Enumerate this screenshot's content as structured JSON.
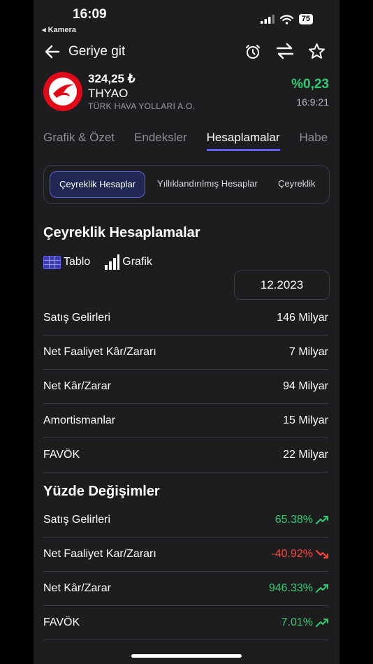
{
  "status_bar": {
    "time": "16:09",
    "back_app": "◂ Kamera",
    "battery": "75"
  },
  "nav": {
    "back_label": "Geriye git"
  },
  "stock": {
    "price": "324,25 ₺",
    "ticker": "THYAO",
    "company": "TÜRK HAVA YOLLARI A.O.",
    "change": "%0,23",
    "time": "16:9:21"
  },
  "tabs": [
    {
      "label": "Grafik & Özet"
    },
    {
      "label": "Endeksler"
    },
    {
      "label": "Hesaplamalar"
    },
    {
      "label": "Habe"
    }
  ],
  "segments": [
    {
      "label": "Çeyreklik Hesaplar"
    },
    {
      "label": "Yıllıklandırılmış Hesaplar"
    },
    {
      "label": "Çeyreklik"
    }
  ],
  "section_title": "Çeyreklik Hesaplamalar",
  "view_switch": {
    "table": "Tablo",
    "chart": "Grafik"
  },
  "period": "12.2023",
  "rows": [
    {
      "label": "Satış Gelirleri",
      "value": "146 Milyar"
    },
    {
      "label": "Net Faaliyet Kâr/Zararı",
      "value": "7 Milyar"
    },
    {
      "label": "Net Kâr/Zarar",
      "value": "94 Milyar"
    },
    {
      "label": "Amortismanlar",
      "value": "15 Milyar"
    },
    {
      "label": "FAVÖK",
      "value": "22 Milyar"
    }
  ],
  "pct_title": "Yüzde Değişimler",
  "pct_rows": [
    {
      "label": "Satış Gelirleri",
      "value": "65.38%"
    },
    {
      "label": "Net Faaliyet Kar/Zararı",
      "value": "-40.92%"
    },
    {
      "label": "Net Kâr/Zarar",
      "value": "946.33%"
    },
    {
      "label": "FAVÖK",
      "value": "7.01%"
    }
  ],
  "colors": {
    "accent": "#5d5cf5",
    "positive": "#2ecc71",
    "negative": "#ff453a",
    "brand": "#e30a17"
  }
}
